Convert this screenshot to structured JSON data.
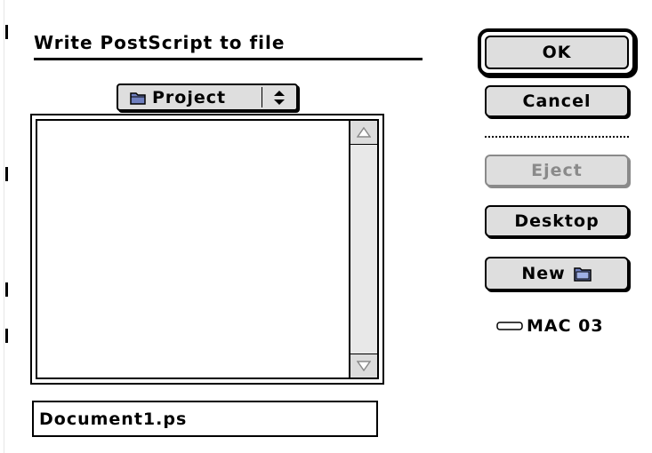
{
  "dialog": {
    "title": "Write PostScript to file",
    "folder_popup": {
      "label": "Project",
      "icon": "folder-icon"
    },
    "file_list": {
      "items": []
    },
    "filename_value": "Document1.ps"
  },
  "buttons": {
    "ok": "OK",
    "cancel": "Cancel",
    "eject": "Eject",
    "desktop": "Desktop",
    "new": "New"
  },
  "volume": {
    "name": "MAC 03",
    "icon": "disk-icon"
  },
  "colors": {
    "button_face": "#dedede",
    "disabled_text": "#8a8a8a",
    "scroll_track": "#e8e8e8"
  }
}
